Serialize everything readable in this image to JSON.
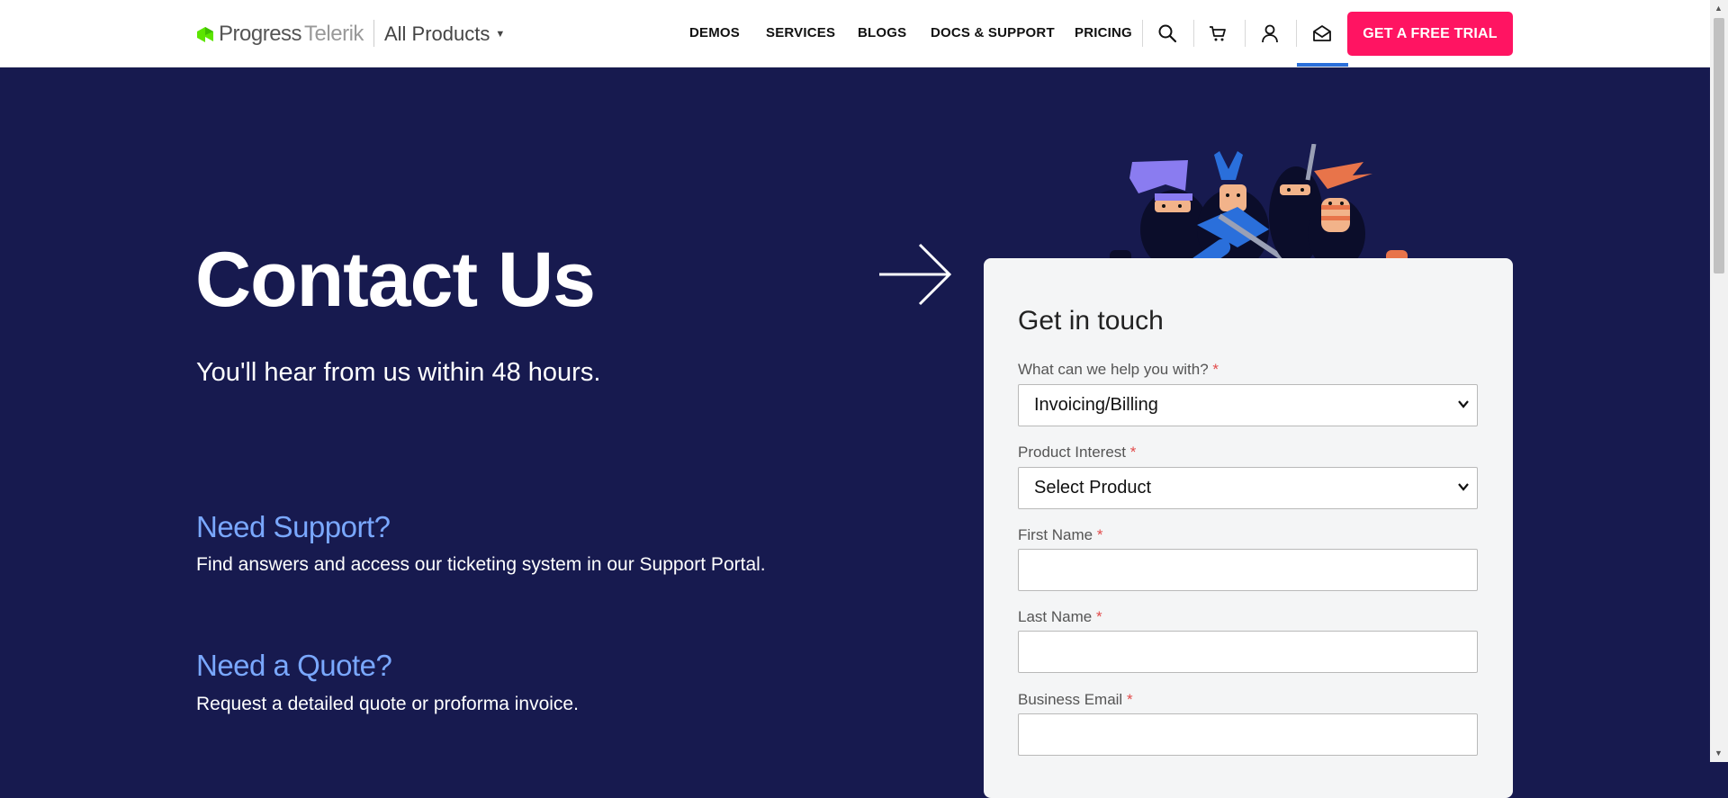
{
  "header": {
    "logo": {
      "progress": "Progress",
      "telerik": "Telerik"
    },
    "all_products": "All Products",
    "nav": [
      "DEMOS",
      "SERVICES",
      "BLOGS",
      "DOCS & SUPPORT",
      "PRICING"
    ],
    "icons": [
      "search-icon",
      "cart-icon",
      "user-icon",
      "mail-icon"
    ],
    "trial_button": "GET A FREE TRIAL"
  },
  "hero": {
    "title": "Contact Us",
    "subtitle": "You'll hear from us within 48 hours."
  },
  "sections": [
    {
      "title": "Need Support?",
      "text": "Find answers and access our ticketing system in our Support Portal."
    },
    {
      "title": "Need a Quote?",
      "text": "Request a detailed quote or proforma invoice."
    }
  ],
  "form": {
    "title": "Get in touch",
    "fields": [
      {
        "label": "What can we help you with?",
        "required": "*",
        "value": "Invoicing/Billing"
      },
      {
        "label": "Product Interest",
        "required": "*",
        "value": "Select Product"
      },
      {
        "label": "First Name",
        "required": "*",
        "value": ""
      },
      {
        "label": "Last Name",
        "required": "*",
        "value": ""
      },
      {
        "label": "Business Email",
        "required": "*",
        "value": ""
      }
    ]
  },
  "colors": {
    "background": "#171a4f",
    "accent": "#ff1462",
    "link": "#7aa8ff"
  }
}
